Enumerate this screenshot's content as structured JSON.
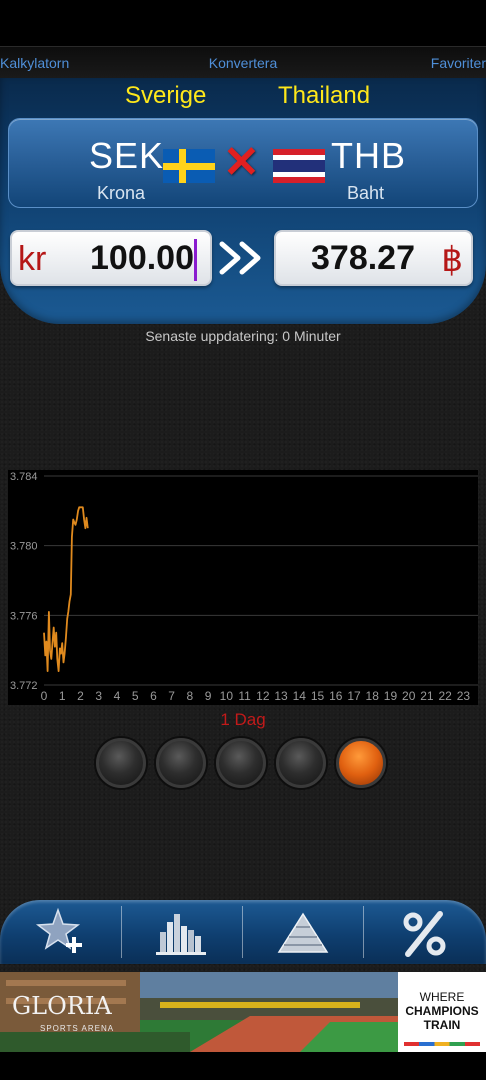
{
  "nav": {
    "left": "Kalkylatorn",
    "center": "Konvertera",
    "right": "Favoriter"
  },
  "from": {
    "country": "Sverige",
    "code": "SEK",
    "name": "Krona",
    "symbol": "kr",
    "amount": "100.00"
  },
  "to": {
    "country": "Thailand",
    "code": "THB",
    "name": "Baht",
    "symbol": "฿",
    "amount": "378.27"
  },
  "update_text": "Senaste uppdatering: 0 Minuter",
  "period_label": "1 Dag",
  "period_selector": {
    "count": 5,
    "active_index": 4
  },
  "icons": {
    "swap": "red-x-swap-icon",
    "convert": "double-chevron-right-icon",
    "tabs": [
      "favorite-add-star-icon",
      "bar-chart-icon",
      "pyramid-icon",
      "percent-icon"
    ]
  },
  "colors": {
    "country": "#ffe81a",
    "symbol": "#b51717",
    "line": "#e08a1e",
    "nav": "#4f8fd8",
    "period": "#c21a1a"
  },
  "ad": {
    "brand": "GLORIA",
    "brand_sub": "SPORTS ARENA",
    "tagline": [
      "WHERE",
      "CHAMPIONS",
      "TRAIN"
    ]
  },
  "chart_data": {
    "type": "line",
    "x_ticks": [
      "0",
      "1",
      "2",
      "3",
      "4",
      "5",
      "6",
      "7",
      "8",
      "9",
      "10",
      "11",
      "12",
      "13",
      "14",
      "15",
      "16",
      "17",
      "18",
      "19",
      "20",
      "21",
      "22",
      "23"
    ],
    "y_ticks": [
      "3.772",
      "3.776",
      "3.780",
      "3.784"
    ],
    "xlim": [
      0,
      23.8
    ],
    "ylim": [
      3.772,
      3.784
    ],
    "grid": true,
    "series": [
      {
        "x": [
          0,
          0.07,
          0.13,
          0.2,
          0.27,
          0.33,
          0.4,
          0.47,
          0.53,
          0.6,
          0.67,
          0.73,
          0.8,
          0.87,
          0.93,
          1.0,
          1.07,
          1.13,
          1.2,
          1.27,
          1.33,
          1.4,
          1.47,
          1.53,
          1.6,
          1.67,
          1.73,
          1.8,
          1.87,
          1.93,
          2.0,
          2.07,
          2.13,
          2.2,
          2.27,
          2.33,
          2.4
        ],
        "y": [
          3.775,
          3.7737,
          3.7745,
          3.7728,
          3.7762,
          3.774,
          3.7735,
          3.7745,
          3.7753,
          3.7742,
          3.775,
          3.7735,
          3.7728,
          3.7741,
          3.7738,
          3.7744,
          3.7733,
          3.7738,
          3.7747,
          3.7758,
          3.7762,
          3.7768,
          3.7772,
          3.7805,
          3.7815,
          3.7813,
          3.7812,
          3.7815,
          3.782,
          3.7822,
          3.7822,
          3.7822,
          3.7822,
          3.7815,
          3.781,
          3.7816,
          3.781
        ]
      }
    ]
  }
}
